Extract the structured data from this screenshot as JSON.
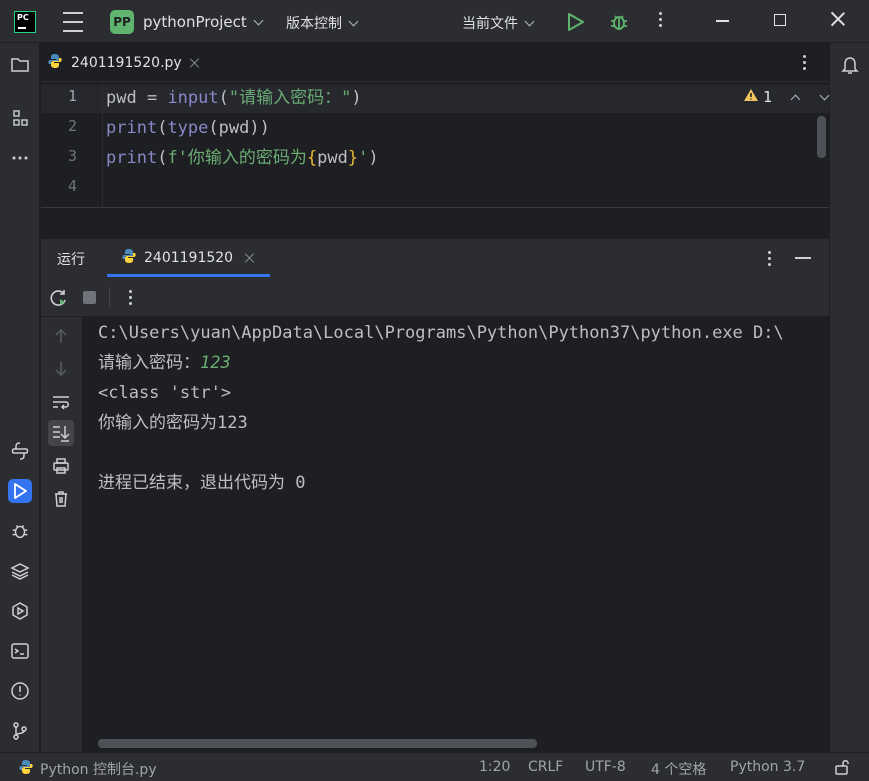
{
  "titlebar": {
    "logo_text": "PC",
    "project_badge": "PP",
    "project_name": "pythonProject",
    "vcs_label": "版本控制",
    "current_file_label": "当前文件",
    "colors": {
      "run": "#5fb56f",
      "debug": "#5fb56f",
      "badge": "#5fb56f"
    }
  },
  "editor": {
    "tab": {
      "label": "2401191520.py",
      "icon": "python-icon"
    },
    "inspection": {
      "icon": "warning-icon",
      "count": "1"
    },
    "line_numbers": [
      "1",
      "2",
      "3",
      "4"
    ],
    "lines": [
      [
        "pwd",
        " = ",
        "input",
        "(",
        "\"请输入密码：\"",
        ")"
      ],
      [
        "print",
        "(",
        "type",
        "(pwd))"
      ],
      [
        "print",
        "(",
        "f'你输入的密码为",
        "{",
        "pwd",
        "}",
        "'",
        ")"
      ]
    ]
  },
  "run_window": {
    "title": "运行",
    "tab_label": "2401191520",
    "tab_icon": "python-icon"
  },
  "console": {
    "lines": [
      "C:\\Users\\yuan\\AppData\\Local\\Programs\\Python\\Python37\\python.exe D:\\",
      "请输入密码：",
      "<class 'str'>",
      "你输入的密码为123",
      "进程已结束，退出代码为 0"
    ],
    "input_echo": "123"
  },
  "statusbar": {
    "console_label": "Python 控制台.py",
    "position": "1:20",
    "line_ending": "CRLF",
    "encoding": "UTF-8",
    "indent": "4 个空格",
    "interpreter": "Python 3.7"
  }
}
